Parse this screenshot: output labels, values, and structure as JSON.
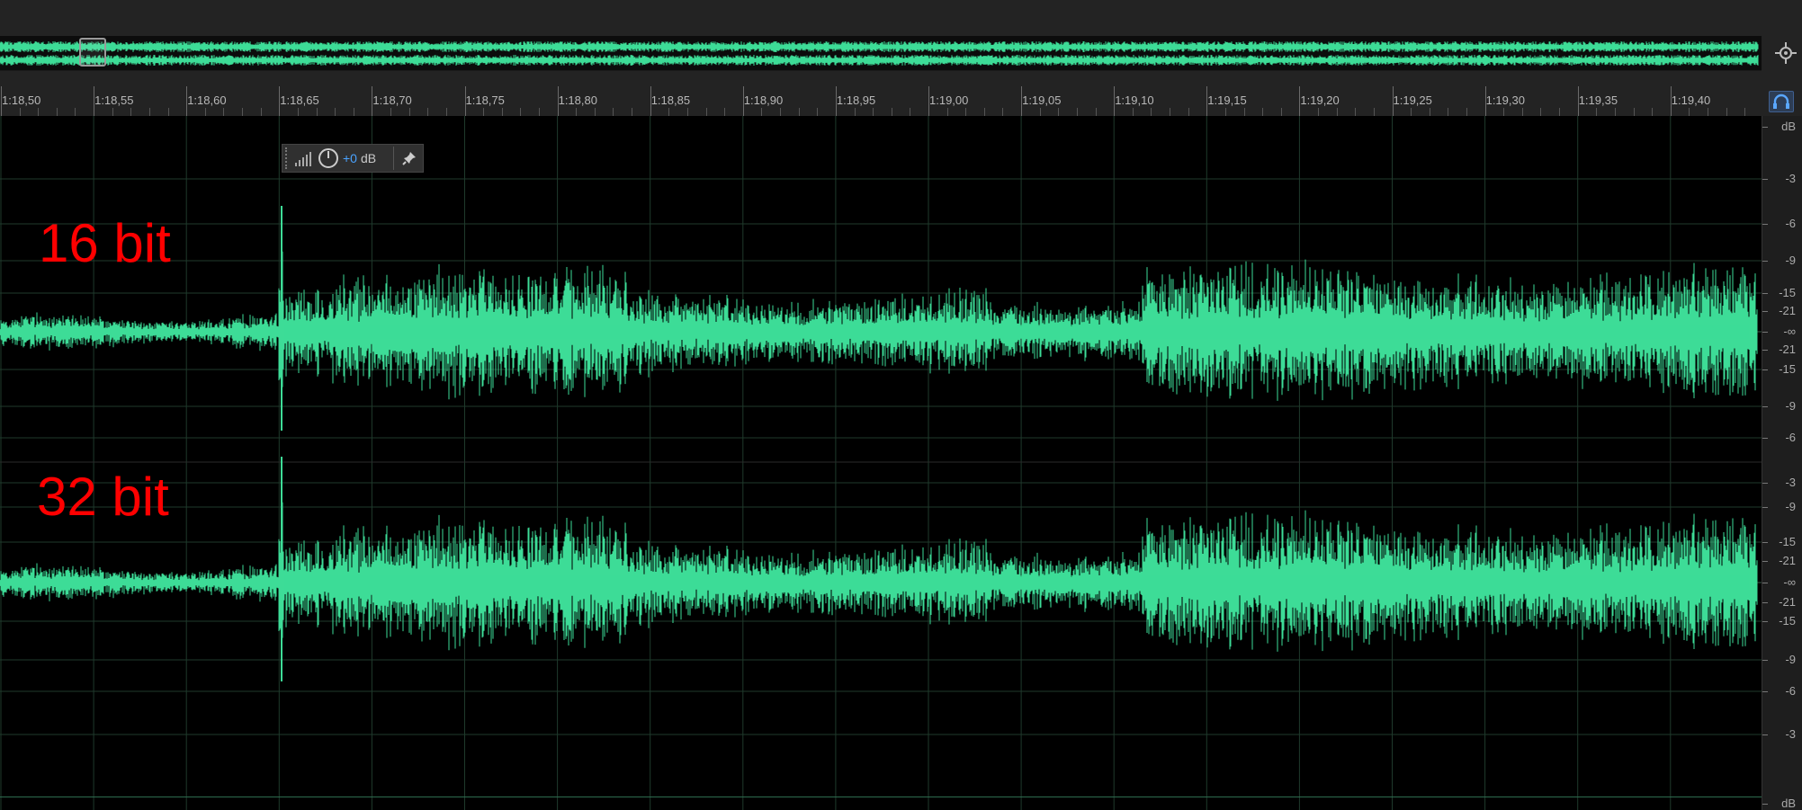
{
  "colors": {
    "waveform": "#3ddc97",
    "waveform_overview": "#3ddc97",
    "background": "#000000",
    "panel": "#232323",
    "grid": "#1f3a2c",
    "label_red": "#ff0000",
    "gain_blue": "#4aa3ff"
  },
  "ruler": {
    "labels": [
      "1:18,50",
      "1:18,55",
      "1:18,60",
      "1:18,65",
      "1:18,70",
      "1:18,75",
      "1:18,80",
      "1:18,85",
      "1:18,90",
      "1:18,95",
      "1:19,00",
      "1:19,05",
      "1:19,10",
      "1:19,15",
      "1:19,20",
      "1:19,25",
      "1:19,30",
      "1:19,35",
      "1:19,40"
    ]
  },
  "db_scale": {
    "unit_top": "dB",
    "unit_bottom": "dB",
    "channel1": [
      "-3",
      "-6",
      "-9",
      "-15",
      "-21",
      "-∞",
      "-21",
      "-15",
      "-9",
      "-6"
    ],
    "channel2": [
      "-3",
      "-9",
      "-15",
      "-21",
      "-∞",
      "-21",
      "-15",
      "-9",
      "-6",
      "-3"
    ]
  },
  "channels": [
    {
      "label": "16 bit"
    },
    {
      "label": "32 bit"
    }
  ],
  "hud": {
    "gain_value": "+0",
    "gain_unit": "dB"
  },
  "icons": {
    "zoom_navigator": "zoom-navigator-icon",
    "snap": "headphones-icon",
    "hud_meter": "volume-meter-icon",
    "hud_knob": "gain-knob-icon",
    "hud_pin": "pin-icon"
  }
}
